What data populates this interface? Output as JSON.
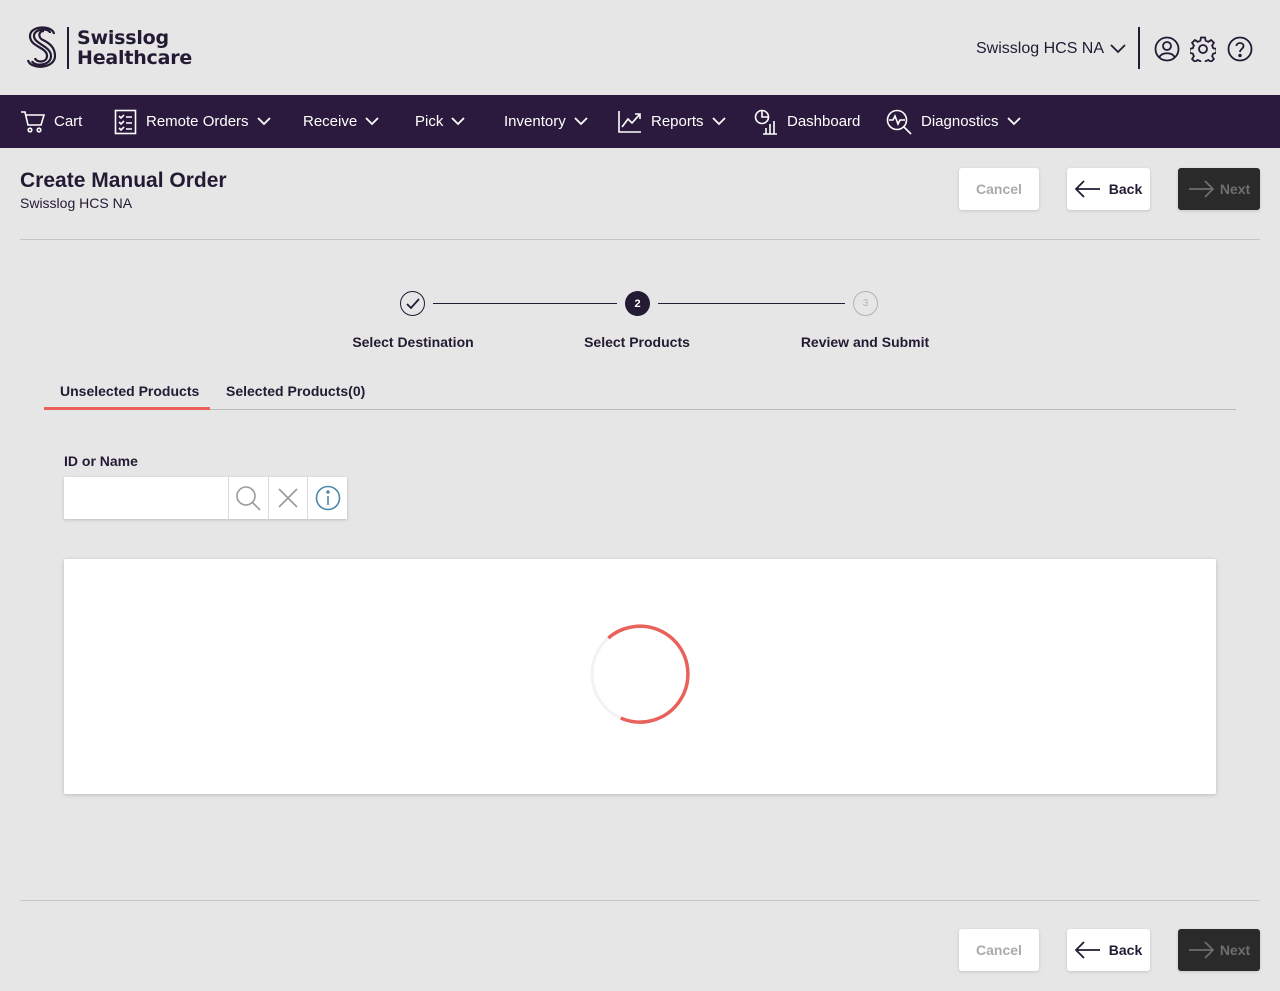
{
  "brand": {
    "line1": "Swisslog",
    "line2": "Healthcare"
  },
  "header": {
    "org_selector": "Swisslog HCS NA",
    "icons": [
      "user-circle-icon",
      "gear-icon",
      "help-circle-icon"
    ]
  },
  "nav": {
    "items": [
      {
        "label": "Cart",
        "icon": "cart-icon",
        "dropdown": false
      },
      {
        "label": "Remote Orders",
        "icon": "checklist-icon",
        "dropdown": true
      },
      {
        "label": "Receive",
        "icon": "",
        "dropdown": true
      },
      {
        "label": "Pick",
        "icon": "",
        "dropdown": true
      },
      {
        "label": "Inventory",
        "icon": "",
        "dropdown": true
      },
      {
        "label": "Reports",
        "icon": "line-chart-icon",
        "dropdown": true
      },
      {
        "label": "Dashboard",
        "icon": "dashboard-icon",
        "dropdown": false
      },
      {
        "label": "Diagnostics",
        "icon": "diagnostics-icon",
        "dropdown": true
      }
    ]
  },
  "page": {
    "title": "Create Manual Order",
    "subtitle": "Swisslog HCS NA"
  },
  "actions": {
    "cancel": "Cancel",
    "back": "Back",
    "next": "Next"
  },
  "stepper": {
    "steps": [
      {
        "label": "Select Destination",
        "state": "completed",
        "number": ""
      },
      {
        "label": "Select Products",
        "state": "active",
        "number": "2"
      },
      {
        "label": "Review and Submit",
        "state": "pending",
        "number": "3"
      }
    ]
  },
  "tabs": [
    {
      "label": "Unselected Products",
      "active": true
    },
    {
      "label": "Selected Products(0)",
      "active": false
    }
  ],
  "search": {
    "label": "ID or Name",
    "value": "",
    "placeholder": ""
  },
  "results": {
    "loading": true
  },
  "colors": {
    "nav_bg": "#2b1a3d",
    "accent": "#e8615a",
    "text": "#231a33",
    "page_bg": "#e6e6e6"
  }
}
